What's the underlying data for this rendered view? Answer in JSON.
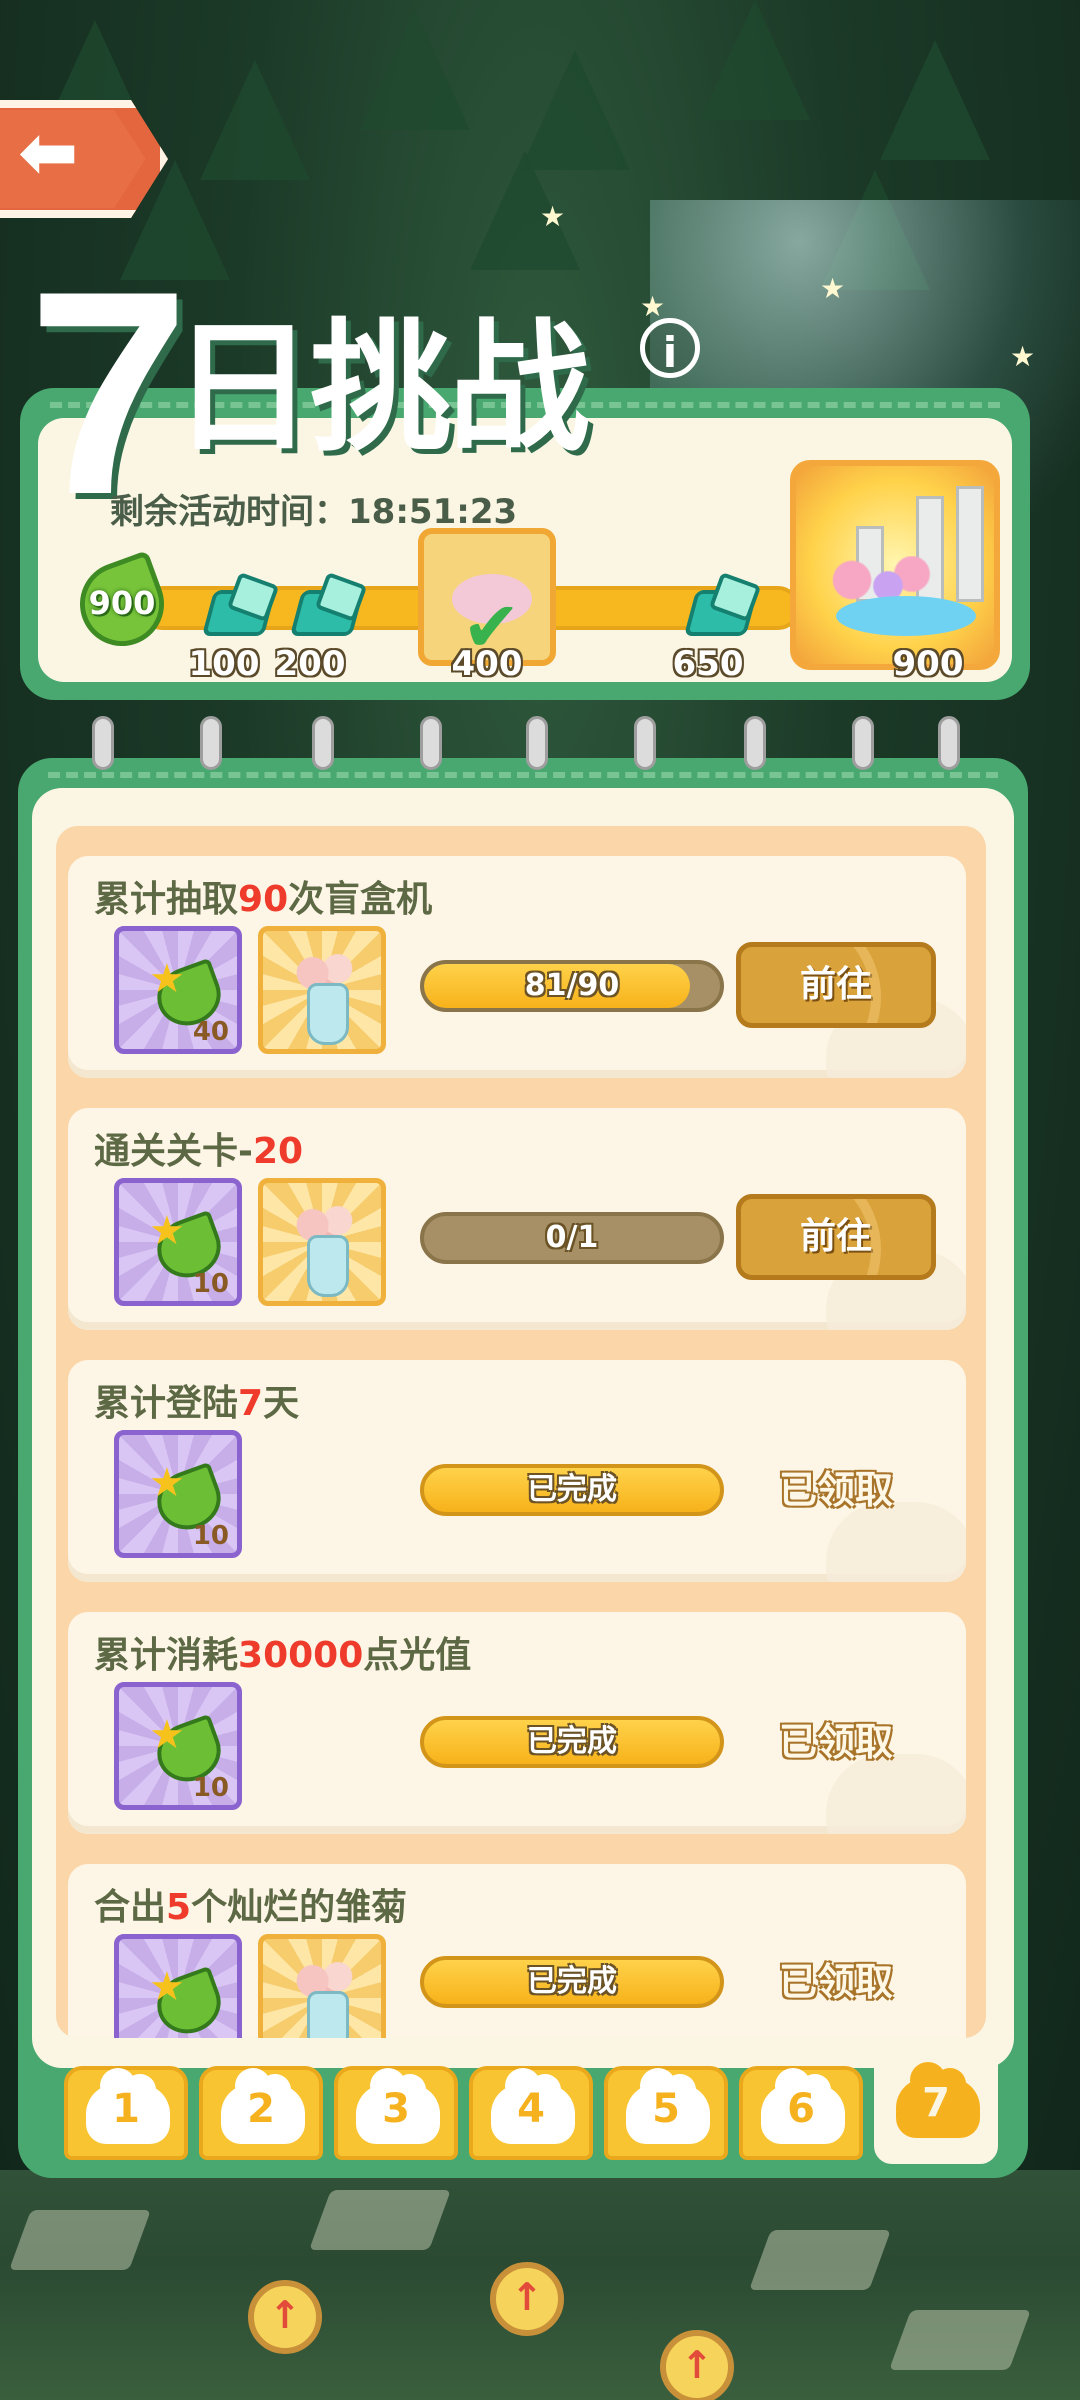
{
  "header": {
    "back_icon": "arrow-left-icon",
    "title_number": "7",
    "title_text": "日挑战",
    "info_icon": "info-icon",
    "info_glyph": "i"
  },
  "progress": {
    "time_label": "剩余活动时间：18:51:23",
    "current_points": "900",
    "milestones": [
      "100",
      "200",
      "400",
      "650",
      "900"
    ]
  },
  "tasks": [
    {
      "title_pre": "累计抽取",
      "title_hl": "90",
      "title_post": "次盲盒机",
      "reward_qty": "40",
      "has_vase": true,
      "progress_label": "81/90",
      "progress_fraction": 0.9,
      "action": "前往",
      "action_type": "go"
    },
    {
      "title_pre": "通关关卡-",
      "title_hl": "20",
      "title_post": "",
      "reward_qty": "10",
      "has_vase": true,
      "progress_label": "0/1",
      "progress_fraction": 0,
      "action": "前往",
      "action_type": "go"
    },
    {
      "title_pre": "累计登陆",
      "title_hl": "7",
      "title_post": "天",
      "reward_qty": "10",
      "has_vase": false,
      "progress_label": "已完成",
      "progress_fraction": 1,
      "action": "已领取",
      "action_type": "claimed"
    },
    {
      "title_pre": "累计消耗",
      "title_hl": "30000",
      "title_post": "点光值",
      "reward_qty": "10",
      "has_vase": false,
      "progress_label": "已完成",
      "progress_fraction": 1,
      "action": "已领取",
      "action_type": "claimed"
    },
    {
      "title_pre": "合出",
      "title_hl": "5",
      "title_post": "个灿烂的雏菊",
      "reward_qty": "",
      "has_vase": true,
      "progress_label": "已完成",
      "progress_fraction": 1,
      "action": "已领取",
      "action_type": "claimed"
    }
  ],
  "day_tabs": [
    "1",
    "2",
    "3",
    "4",
    "5",
    "6",
    "7"
  ],
  "active_day": "7",
  "colors": {
    "panel_green": "#48a86f",
    "cream": "#fbf5e3",
    "highlight_red": "#ee3b2b",
    "progress_yellow": "#f7b21a",
    "button_gold": "#d9a23a"
  }
}
